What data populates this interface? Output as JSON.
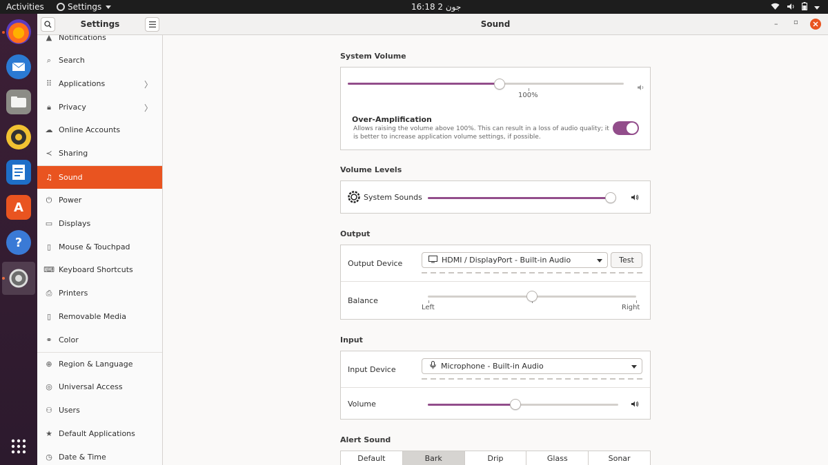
{
  "topbar": {
    "activities": "Activities",
    "app_menu": "Settings",
    "clock": "16:18  2 جون"
  },
  "sidebar": {
    "title": "Settings",
    "items": [
      {
        "label": "Notifications",
        "icon": "bell-icon"
      },
      {
        "label": "Search",
        "icon": "search-icon"
      },
      {
        "label": "Applications",
        "icon": "grid-icon",
        "chevron": true
      },
      {
        "label": "Privacy",
        "icon": "lock-icon",
        "chevron": true
      },
      {
        "label": "Online Accounts",
        "icon": "cloud-icon"
      },
      {
        "label": "Sharing",
        "icon": "share-icon"
      },
      {
        "label": "Sound",
        "icon": "music-note-icon",
        "active": true
      },
      {
        "label": "Power",
        "icon": "power-icon"
      },
      {
        "label": "Displays",
        "icon": "display-icon"
      },
      {
        "label": "Mouse & Touchpad",
        "icon": "mouse-icon"
      },
      {
        "label": "Keyboard Shortcuts",
        "icon": "keyboard-icon"
      },
      {
        "label": "Printers",
        "icon": "printer-icon"
      },
      {
        "label": "Removable Media",
        "icon": "usb-drive-icon"
      },
      {
        "label": "Color",
        "icon": "color-icon"
      },
      {
        "label": "Region & Language",
        "icon": "globe-icon"
      },
      {
        "label": "Universal Access",
        "icon": "accessibility-icon"
      },
      {
        "label": "Users",
        "icon": "user-icon"
      },
      {
        "label": "Default Applications",
        "icon": "star-icon"
      },
      {
        "label": "Date & Time",
        "icon": "clock-icon"
      }
    ]
  },
  "header": {
    "title": "Sound"
  },
  "system_volume": {
    "section_title": "System Volume",
    "level": 0.55,
    "mark_label": "100%",
    "over_amp_title": "Over-Amplification",
    "over_amp_desc_1": "Allows raising the volume above 100%. This can result in a loss of audio quality; it",
    "over_amp_desc_2": "is better to increase application volume settings, if possible.",
    "over_amp_enabled": true
  },
  "volume_levels": {
    "section_title": "Volume Levels",
    "system_sounds_label": "System Sounds",
    "level": 0.98
  },
  "output": {
    "section_title": "Output",
    "device_label": "Output Device",
    "device_value": "HDMI / DisplayPort - Built-in Audio",
    "test_label": "Test",
    "balance_label": "Balance",
    "balance_left": "Left",
    "balance_right": "Right",
    "balance": 0.5
  },
  "input": {
    "section_title": "Input",
    "device_label": "Input Device",
    "device_value": "Microphone - Built-in Audio",
    "volume_label": "Volume",
    "level": 0.46
  },
  "alert_sound": {
    "section_title": "Alert Sound",
    "options": [
      "Default",
      "Bark",
      "Drip",
      "Glass",
      "Sonar"
    ],
    "selected": "Bark"
  },
  "colors": {
    "accent": "#e95420",
    "slider_fill": "#924d8b"
  }
}
